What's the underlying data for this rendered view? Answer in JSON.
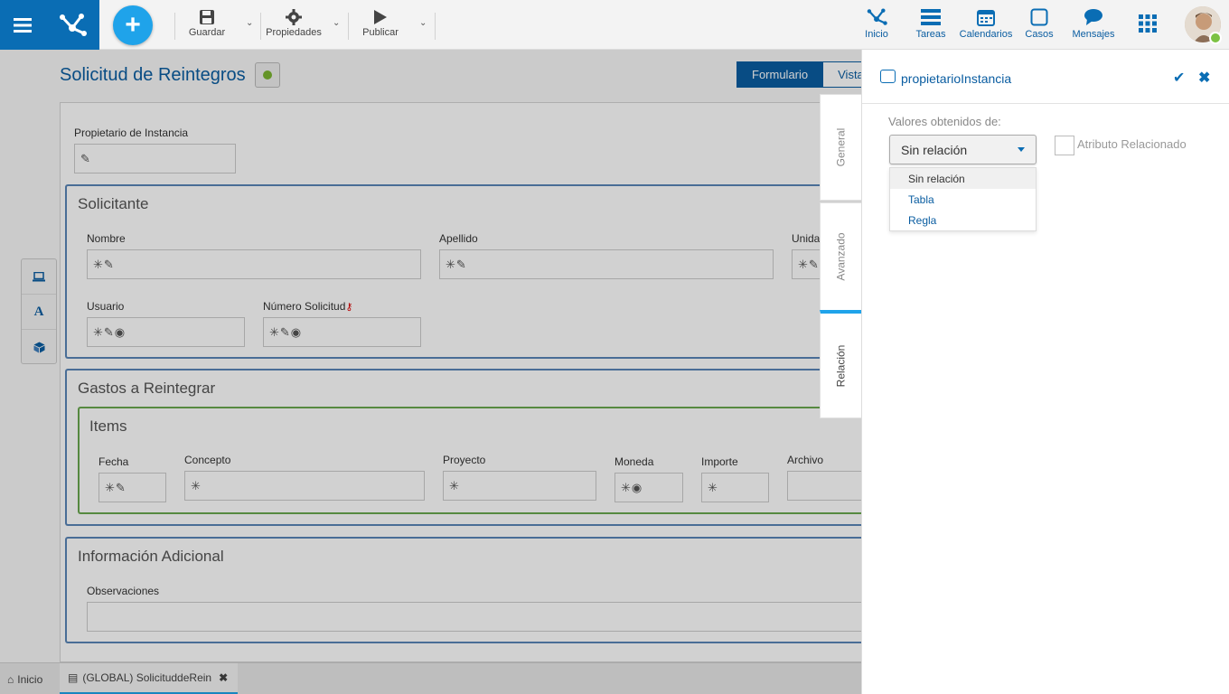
{
  "toolbar": {
    "save_label": "Guardar",
    "properties_label": "Propiedades",
    "publish_label": "Publicar"
  },
  "nav": {
    "inicio": "Inicio",
    "tareas": "Tareas",
    "calendarios": "Calendarios",
    "casos": "Casos",
    "mensajes": "Mensajes"
  },
  "form": {
    "title": "Solicitud de Reintegros",
    "view_tabs": [
      "Formulario",
      "Vista"
    ],
    "owner_label": "Propietario de Instancia",
    "groups": {
      "solicitante": {
        "title": "Solicitante",
        "nombre": "Nombre",
        "apellido": "Apellido",
        "unidad": "Unida",
        "usuario": "Usuario",
        "numero": "Número Solicitud"
      },
      "gastos": {
        "title": "Gastos a Reintegrar",
        "items_title": "Items",
        "columns": [
          "Fecha",
          "Concepto",
          "Proyecto",
          "Moneda",
          "Importe",
          "Archivo"
        ]
      },
      "info": {
        "title": "Información Adicional",
        "observaciones": "Observaciones"
      }
    }
  },
  "side_tools": [
    "laptop-icon",
    "A",
    "cube-icon"
  ],
  "vertical_tabs": [
    "General",
    "Avanzado",
    "Relación"
  ],
  "bottom_tabs": {
    "home": "Inicio",
    "doc": "(GLOBAL) SolicituddeRein"
  },
  "panel": {
    "title": "propietarioInstancia",
    "values_label": "Valores obtenidos de:",
    "select_value": "Sin relación",
    "options": [
      "Sin relación",
      "Tabla",
      "Regla"
    ],
    "attr_label": "Atributo Relacionado"
  },
  "colors": {
    "primary": "#0a6db4",
    "accent": "#1fa3ea",
    "group_border": "#5a86b8",
    "items_border": "#6aa84f"
  }
}
